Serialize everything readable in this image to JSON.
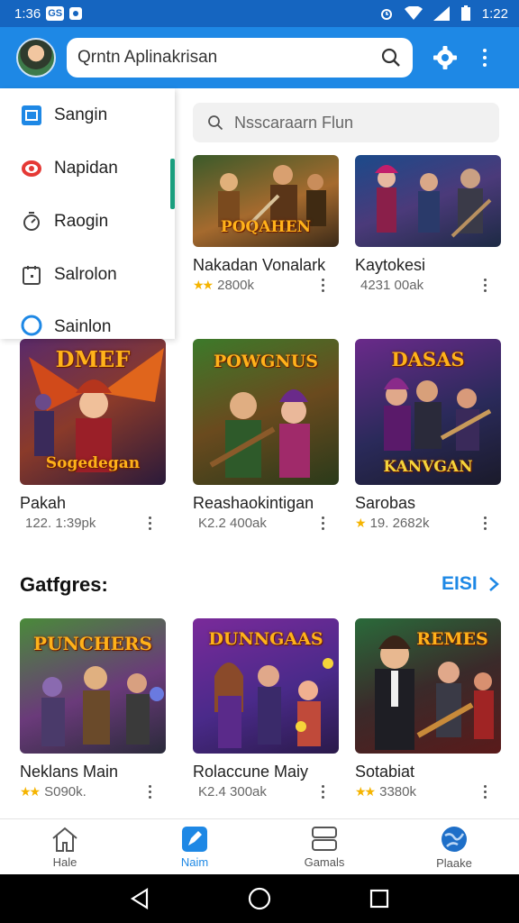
{
  "status_bar": {
    "time": "1:36",
    "badge": "GS",
    "clock": "1:22"
  },
  "app_bar": {
    "search_text": "Qrntn Aplinakrisan"
  },
  "drawer": {
    "items": [
      {
        "label": "Sangin",
        "icon": "square-icon"
      },
      {
        "label": "Napidan",
        "icon": "record-icon"
      },
      {
        "label": "Raogin",
        "icon": "timer-icon"
      },
      {
        "label": "Salrolon",
        "icon": "calendar-icon"
      },
      {
        "label": "Sainlon",
        "icon": "circle-icon"
      }
    ]
  },
  "search2": {
    "placeholder": "Nsscaraarn Flun"
  },
  "grid_top": [
    {
      "title": "Nakadan Vonalark",
      "meta": "2800k",
      "stars": "★★",
      "art": "POQAHEN"
    },
    {
      "title": "Kaytokesi",
      "meta": "4231 00ak",
      "stars": "",
      "art": ""
    },
    {
      "title": "Pakah",
      "meta": "122. 1:39pk",
      "stars": "",
      "art": "Sogedegan"
    },
    {
      "title": "Reashaokintigan",
      "meta": "K2.2 400ak",
      "stars": "",
      "art": "POWGNUS"
    },
    {
      "title": "Sarobas",
      "meta": "19. 2682k",
      "stars": "★",
      "art": "KANVGAN"
    }
  ],
  "art_top_extra": {
    "card3": "DMEF",
    "card5": "DASAS"
  },
  "section": {
    "title": "Gatfgres:",
    "more": "EISI"
  },
  "grid_bottom": [
    {
      "title": "Neklans Main",
      "meta": "S090k.",
      "stars": "★★",
      "art": "PUNCHERS"
    },
    {
      "title": "Rolaccune Maiy",
      "meta": "K2.4 300ak",
      "stars": "",
      "art": "DUNNGAAS"
    },
    {
      "title": "Sotabiat",
      "meta": "3380k",
      "stars": "★★",
      "art": "REMES"
    }
  ],
  "bottom_nav": [
    {
      "label": "Hale",
      "icon": "home-icon"
    },
    {
      "label": "Naim",
      "icon": "pen-icon"
    },
    {
      "label": "Gamals",
      "icon": "stack-icon"
    },
    {
      "label": "Plaake",
      "icon": "globe-icon"
    }
  ],
  "colors": {
    "primary": "#1e88e5",
    "status_bar": "#1565c0",
    "accent_teal": "#1a9e7e",
    "star": "#f5b400"
  }
}
